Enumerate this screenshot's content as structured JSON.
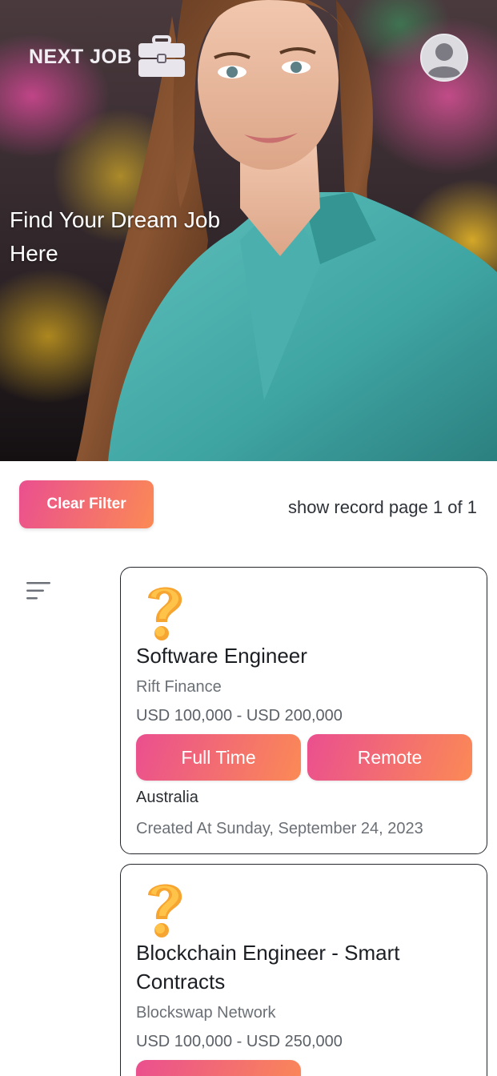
{
  "header": {
    "brand": "NEXT JOB",
    "hero_title": "Find Your Dream Job Here"
  },
  "toolbar": {
    "clear_filter_label": "Clear Filter",
    "page_info": "show record page 1 of 1"
  },
  "jobs": [
    {
      "title": "Software Engineer",
      "company": "Rift Finance",
      "salary": "USD 100,000 - USD 200,000",
      "employment_type": "Full Time",
      "work_mode": "Remote",
      "location": "Australia",
      "created": "Created At Sunday, September 24, 2023"
    },
    {
      "title": "Blockchain Engineer - Smart Contracts",
      "company": "Blockswap Network",
      "salary": "USD 100,000 - USD 250,000",
      "employment_type": "",
      "work_mode": "",
      "location": "",
      "created": ""
    }
  ],
  "colors": {
    "accent_start": "#ea4f8f",
    "accent_end": "#fb8a55",
    "card_border": "#23262b"
  },
  "icons": {
    "brand": "briefcase-icon",
    "profile": "user-avatar-icon",
    "filter": "filter-menu-icon",
    "job": "question-mark-icon"
  }
}
